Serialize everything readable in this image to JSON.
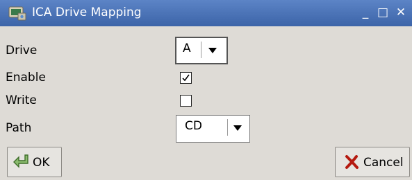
{
  "window": {
    "title": "ICA Drive Mapping",
    "controls": {
      "minimize": "_",
      "maximize": "□",
      "close": "✕"
    }
  },
  "form": {
    "drive": {
      "label": "Drive",
      "value": "A"
    },
    "enable": {
      "label": "Enable",
      "checked": true
    },
    "write": {
      "label": "Write",
      "checked": false
    },
    "path": {
      "label": "Path",
      "value": "CD"
    }
  },
  "buttons": {
    "ok": {
      "label": "OK",
      "icon": "ok-arrow-icon"
    },
    "cancel": {
      "label": "Cancel",
      "icon": "cancel-x-icon"
    }
  },
  "colors": {
    "titlebar": "#4a72b8",
    "background": "#dedbd6",
    "cancel_icon": "#b51a10"
  }
}
